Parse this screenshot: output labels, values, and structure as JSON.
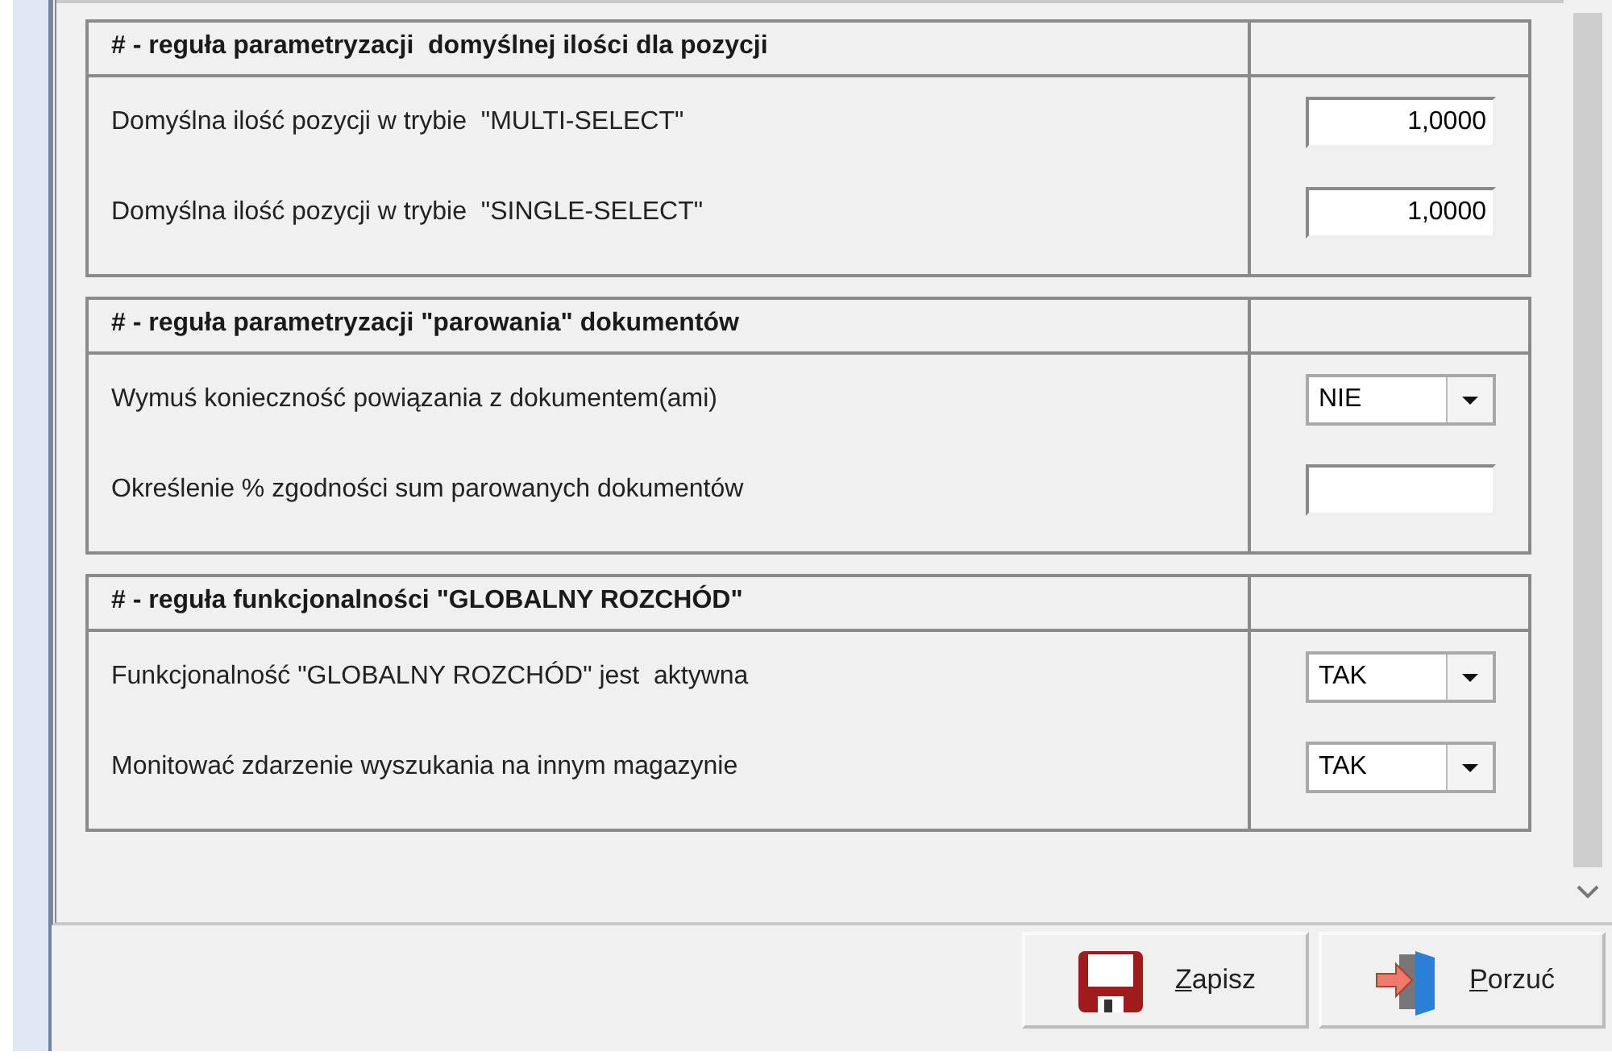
{
  "groups": [
    {
      "title": "# - reguła parametryzacji  domyślnej ilości dla pozycji",
      "rows": [
        {
          "kind": "number",
          "label": "Domyślna ilość pozycji w trybie  \"MULTI-SELECT\"",
          "value": "1,0000"
        },
        {
          "kind": "number",
          "label": "Domyślna ilość pozycji w trybie  \"SINGLE-SELECT\"",
          "value": "1,0000"
        }
      ]
    },
    {
      "title": "# - reguła parametryzacji \"parowania\" dokumentów",
      "rows": [
        {
          "kind": "select",
          "label": "Wymuś konieczność powiązania z dokumentem(ami)",
          "value": "NIE"
        },
        {
          "kind": "text",
          "label": "Określenie % zgodności sum parowanych dokumentów"
        }
      ]
    },
    {
      "title": "# - reguła funkcjonalności \"GLOBALNY ROZCHÓD\"",
      "rows": [
        {
          "kind": "select",
          "label": "Funkcjonalność \"GLOBALNY ROZCHÓD\" jest  aktywna",
          "value": "TAK"
        },
        {
          "kind": "select",
          "label": "Monitować zdarzenie wyszukania na innym magazynie",
          "value": "TAK"
        }
      ]
    }
  ],
  "buttons": [
    {
      "kind": "save",
      "label": "Zapisz"
    },
    {
      "kind": "discard",
      "label": "Porzuć"
    }
  ]
}
